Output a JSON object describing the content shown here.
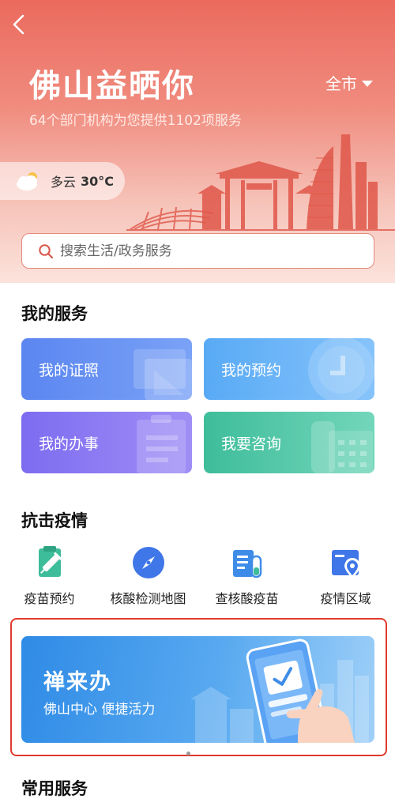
{
  "header": {
    "title": "佛山益晒你",
    "city": "全市",
    "subtitle": "64个部门机构为您提供1102项服务",
    "weather": {
      "condition": "多云",
      "temperature": "30°C",
      "icon": "cloudy-sun-icon"
    }
  },
  "search": {
    "placeholder": "搜索生活/政务服务"
  },
  "my_services": {
    "title": "我的服务",
    "cards": [
      {
        "label": "我的证照",
        "icon": "certificate-icon",
        "color": "#5b86f0"
      },
      {
        "label": "我的预约",
        "icon": "clock-icon",
        "color": "#58aaf5"
      },
      {
        "label": "我的办事",
        "icon": "clipboard-icon",
        "color": "#7d6cf0"
      },
      {
        "label": "我要咨询",
        "icon": "telephone-icon",
        "color": "#3ebd9a"
      }
    ]
  },
  "epidemic": {
    "title": "抗击疫情",
    "items": [
      {
        "label": "疫苗预约",
        "icon": "vaccine-icon",
        "color": "#3ebd9a"
      },
      {
        "label": "核酸检测地图",
        "icon": "compass-icon",
        "color": "#3f76e8"
      },
      {
        "label": "查核酸疫苗",
        "icon": "test-tube-icon",
        "color": "#3f8ce8"
      },
      {
        "label": "疫情区域",
        "icon": "map-pin-icon",
        "color": "#3f76e8"
      }
    ]
  },
  "banner": {
    "title": "禅来办",
    "subtitle": "佛山中心  便捷活力"
  },
  "carousel": {
    "count": 2,
    "active": 1
  },
  "common_services": {
    "title": "常用服务"
  },
  "colors": {
    "accent": "#ea6a5d",
    "highlight_border": "#e03a2e"
  }
}
